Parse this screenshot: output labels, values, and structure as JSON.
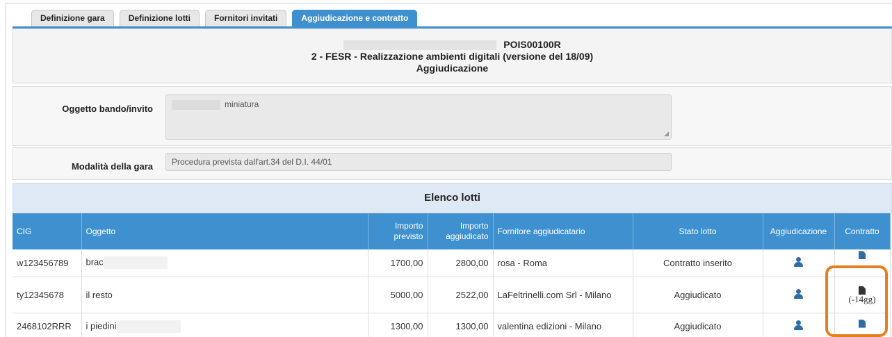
{
  "tabs": [
    {
      "label": "Definizione gara"
    },
    {
      "label": "Definizione lotti"
    },
    {
      "label": "Fornitori invitati"
    },
    {
      "label": "Aggiudicazione e contratto"
    }
  ],
  "header": {
    "code": "POIS00100R",
    "subtitle": "2 - FESR - Realizzazione ambienti digitali (versione del 18/09)",
    "section": "Aggiudicazione"
  },
  "form": {
    "oggetto_label": "Oggetto bando/invito",
    "oggetto_value": "miniatura",
    "modalita_label": "Modalità  della gara",
    "modalita_value": "Procedura prevista dall'art.34 del D.I. 44/01"
  },
  "lotti": {
    "title": "Elenco lotti",
    "columns": [
      "CIG",
      "Oggetto",
      "Importo previsto",
      "Importo aggiudicato",
      "Fornitore aggiudicatario",
      "Stato lotto",
      "Aggiudicazione",
      "Contratto"
    ],
    "rows": [
      {
        "cig": "w123456789",
        "oggetto": "brac",
        "importo_previsto": "1700,00",
        "importo_aggiudicato": "2800,00",
        "fornitore": "rosa          - Roma",
        "stato": "Contratto inserito",
        "contratto_note": ""
      },
      {
        "cig": "ty12345678",
        "oggetto": "il resto",
        "importo_previsto": "5000,00",
        "importo_aggiudicato": "2522,00",
        "fornitore": "LaFeltrinelli.com Srl - Milano",
        "stato": "Aggiudicato",
        "contratto_note": "(-14gg)"
      },
      {
        "cig": "2468102RRR",
        "oggetto": "i piedini",
        "importo_previsto": "1300,00",
        "importo_aggiudicato": "1300,00",
        "fornitore": "valentina edizioni - Milano",
        "stato": "Aggiudicato",
        "contratto_note": ""
      }
    ]
  },
  "colors": {
    "accent": "#3e90cf",
    "highlight": "#e3801f",
    "icon": "#2e6da4"
  }
}
